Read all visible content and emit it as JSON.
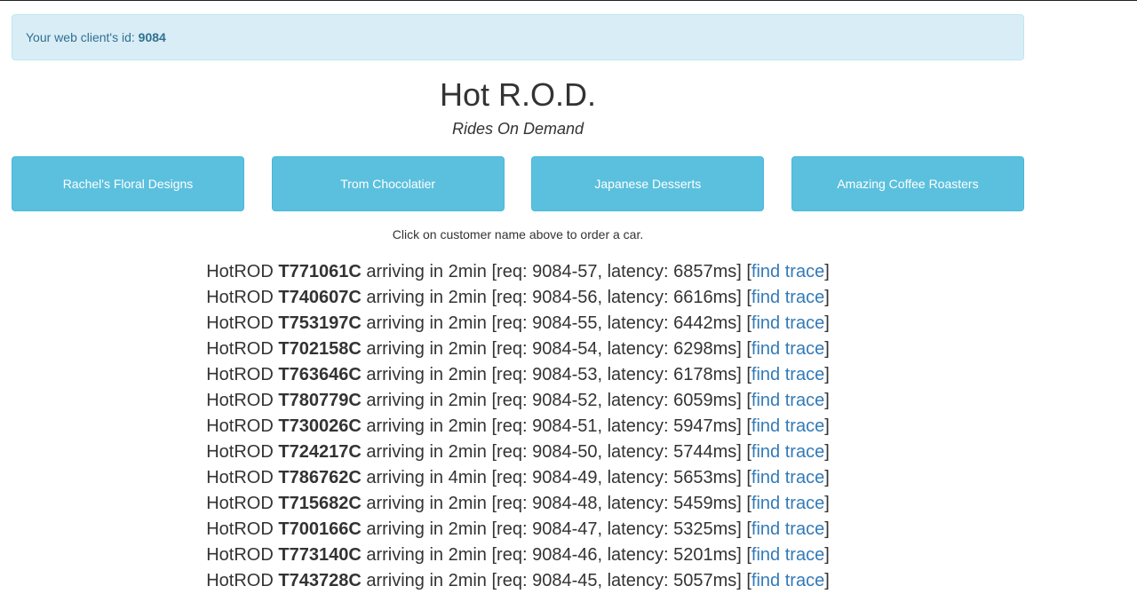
{
  "alert": {
    "prefix": "Your web client's id: ",
    "client_id": "9084"
  },
  "header": {
    "title": "Hot R.O.D.",
    "subtitle": "Rides On Demand"
  },
  "customers": [
    {
      "label": "Rachel's Floral Designs"
    },
    {
      "label": "Trom Chocolatier"
    },
    {
      "label": "Japanese Desserts"
    },
    {
      "label": "Amazing Coffee Roasters"
    }
  ],
  "hint": "Click on customer name above to order a car.",
  "ride_labels": {
    "prefix": "HotROD ",
    "arriving": " arriving in ",
    "req": " [req: ",
    "latency": ", latency: ",
    "close_open": "] [",
    "link": "find trace",
    "close": "]"
  },
  "rides": [
    {
      "car": "T771061C",
      "eta": "2min",
      "req": "9084-57",
      "latency": "6857ms"
    },
    {
      "car": "T740607C",
      "eta": "2min",
      "req": "9084-56",
      "latency": "6616ms"
    },
    {
      "car": "T753197C",
      "eta": "2min",
      "req": "9084-55",
      "latency": "6442ms"
    },
    {
      "car": "T702158C",
      "eta": "2min",
      "req": "9084-54",
      "latency": "6298ms"
    },
    {
      "car": "T763646C",
      "eta": "2min",
      "req": "9084-53",
      "latency": "6178ms"
    },
    {
      "car": "T780779C",
      "eta": "2min",
      "req": "9084-52",
      "latency": "6059ms"
    },
    {
      "car": "T730026C",
      "eta": "2min",
      "req": "9084-51",
      "latency": "5947ms"
    },
    {
      "car": "T724217C",
      "eta": "2min",
      "req": "9084-50",
      "latency": "5744ms"
    },
    {
      "car": "T786762C",
      "eta": "4min",
      "req": "9084-49",
      "latency": "5653ms"
    },
    {
      "car": "T715682C",
      "eta": "2min",
      "req": "9084-48",
      "latency": "5459ms"
    },
    {
      "car": "T700166C",
      "eta": "2min",
      "req": "9084-47",
      "latency": "5325ms"
    },
    {
      "car": "T773140C",
      "eta": "2min",
      "req": "9084-46",
      "latency": "5201ms"
    },
    {
      "car": "T743728C",
      "eta": "2min",
      "req": "9084-45",
      "latency": "5057ms"
    }
  ]
}
